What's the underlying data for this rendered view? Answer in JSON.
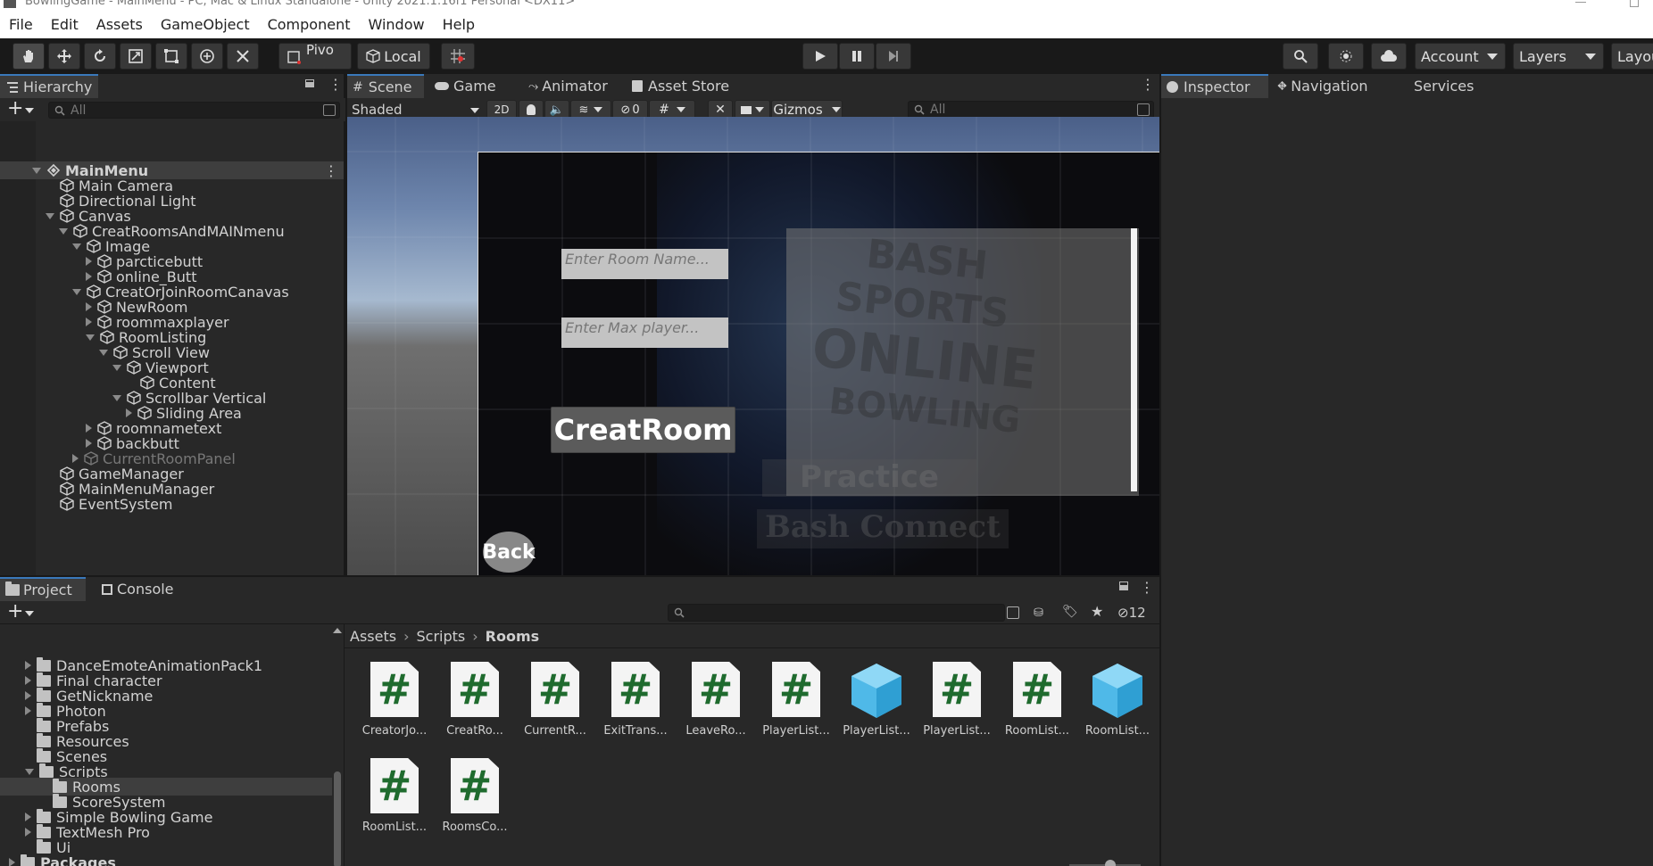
{
  "window": {
    "title": "BowlingGame - MainMenu - PC, Mac & Linux Standalone - Unity 2021.1.16f1 Personal <DX11>"
  },
  "menu": [
    "File",
    "Edit",
    "Assets",
    "GameObject",
    "Component",
    "Window",
    "Help"
  ],
  "toolbar": {
    "pivot": "Pivo",
    "local": "Local",
    "account": "Account",
    "layers": "Layers",
    "layout": "Layou"
  },
  "hierarchy": {
    "tab": "Hierarchy",
    "search_placeholder": "All",
    "items": [
      {
        "label": "MainMenu",
        "indent": 0,
        "expander": "down",
        "icon": "scene",
        "bold": true,
        "dim": false,
        "selected": true
      },
      {
        "label": "Main Camera",
        "indent": 1,
        "expander": "none",
        "icon": "cube",
        "bold": false,
        "dim": false
      },
      {
        "label": "Directional Light",
        "indent": 1,
        "expander": "none",
        "icon": "cube",
        "bold": false,
        "dim": false
      },
      {
        "label": "Canvas",
        "indent": 1,
        "expander": "down",
        "icon": "cube",
        "bold": false,
        "dim": false
      },
      {
        "label": "CreatRoomsAndMAINmenu",
        "indent": 2,
        "expander": "down",
        "icon": "cube",
        "bold": false,
        "dim": false
      },
      {
        "label": "Image",
        "indent": 3,
        "expander": "down",
        "icon": "cube",
        "bold": false,
        "dim": false
      },
      {
        "label": "parcticebutt",
        "indent": 4,
        "expander": "right",
        "icon": "cube",
        "bold": false,
        "dim": false
      },
      {
        "label": "online_Butt",
        "indent": 4,
        "expander": "right",
        "icon": "cube",
        "bold": false,
        "dim": false
      },
      {
        "label": "CreatOrJoinRoomCanavas",
        "indent": 3,
        "expander": "down",
        "icon": "cube",
        "bold": false,
        "dim": false
      },
      {
        "label": "NewRoom",
        "indent": 4,
        "expander": "right",
        "icon": "cube",
        "bold": false,
        "dim": false
      },
      {
        "label": "roommaxplayer",
        "indent": 4,
        "expander": "right",
        "icon": "cube",
        "bold": false,
        "dim": false
      },
      {
        "label": "RoomListing",
        "indent": 4,
        "expander": "down",
        "icon": "cube",
        "bold": false,
        "dim": false
      },
      {
        "label": "Scroll View",
        "indent": 5,
        "expander": "down",
        "icon": "cube",
        "bold": false,
        "dim": false
      },
      {
        "label": "Viewport",
        "indent": 6,
        "expander": "down",
        "icon": "cube",
        "bold": false,
        "dim": false
      },
      {
        "label": "Content",
        "indent": 7,
        "expander": "none",
        "icon": "cube",
        "bold": false,
        "dim": false
      },
      {
        "label": "Scrollbar Vertical",
        "indent": 6,
        "expander": "down",
        "icon": "cube",
        "bold": false,
        "dim": false
      },
      {
        "label": "Sliding Area",
        "indent": 7,
        "expander": "right",
        "icon": "cube",
        "bold": false,
        "dim": false
      },
      {
        "label": "roomnametext",
        "indent": 4,
        "expander": "right",
        "icon": "cube",
        "bold": false,
        "dim": false
      },
      {
        "label": "backbutt",
        "indent": 4,
        "expander": "right",
        "icon": "cube",
        "bold": false,
        "dim": false
      },
      {
        "label": "CurrentRoomPanel",
        "indent": 3,
        "expander": "right",
        "icon": "cube",
        "bold": false,
        "dim": true
      },
      {
        "label": "GameManager",
        "indent": 1,
        "expander": "none",
        "icon": "cube",
        "bold": false,
        "dim": false
      },
      {
        "label": "MainMenuManager",
        "indent": 1,
        "expander": "none",
        "icon": "cube",
        "bold": false,
        "dim": false
      },
      {
        "label": "EventSystem",
        "indent": 1,
        "expander": "none",
        "icon": "cube",
        "bold": false,
        "dim": false
      }
    ]
  },
  "scene": {
    "tabs": [
      "Scene",
      "Game",
      "Animator",
      "Asset Store"
    ],
    "shading": "Shaded",
    "mode_2d": "2D",
    "hidden_count": "0",
    "gizmos": "Gizmos",
    "search_placeholder": "All",
    "ui": {
      "room_name_placeholder": "Enter Room Name...",
      "max_player_placeholder": "Enter Max player...",
      "create_button": "CreatRoom",
      "back_button": "Back",
      "bg_line1": "BASH SPORTS",
      "bg_line2": "ONLINE",
      "bg_line3": "BOWLING",
      "bg_practice": "Practice",
      "bg_connect": "Bash Connect"
    }
  },
  "inspector": {
    "tabs": [
      "Inspector",
      "Navigation",
      "Services"
    ]
  },
  "project": {
    "tabs": [
      "Project",
      "Console"
    ],
    "hidden_count": "12",
    "breadcrumb": [
      "Assets",
      "Scripts",
      "Rooms"
    ],
    "folders": [
      {
        "label": "DanceEmoteAnimationPack1",
        "indent": 1,
        "expander": "right",
        "open": false
      },
      {
        "label": "Final character",
        "indent": 1,
        "expander": "right",
        "open": false
      },
      {
        "label": "GetNickname",
        "indent": 1,
        "expander": "right",
        "open": false
      },
      {
        "label": "Photon",
        "indent": 1,
        "expander": "right",
        "open": false
      },
      {
        "label": "Prefabs",
        "indent": 1,
        "expander": "none",
        "open": false
      },
      {
        "label": "Resources",
        "indent": 1,
        "expander": "none",
        "open": false
      },
      {
        "label": "Scenes",
        "indent": 1,
        "expander": "none",
        "open": false
      },
      {
        "label": "Scripts",
        "indent": 1,
        "expander": "down",
        "open": true
      },
      {
        "label": "Rooms",
        "indent": 2,
        "expander": "none",
        "open": false,
        "selected": true
      },
      {
        "label": "ScoreSystem",
        "indent": 2,
        "expander": "none",
        "open": false
      },
      {
        "label": "Simple Bowling Game",
        "indent": 1,
        "expander": "right",
        "open": false
      },
      {
        "label": "TextMesh Pro",
        "indent": 1,
        "expander": "right",
        "open": false
      },
      {
        "label": "Ui",
        "indent": 1,
        "expander": "none",
        "open": false
      },
      {
        "label": "Packages",
        "indent": 0,
        "expander": "right",
        "open": false,
        "bold": true
      }
    ],
    "assets": [
      {
        "label": "CreatorJo...",
        "type": "script"
      },
      {
        "label": "CreatRo...",
        "type": "script"
      },
      {
        "label": "CurrentR...",
        "type": "script"
      },
      {
        "label": "ExitTrans...",
        "type": "script"
      },
      {
        "label": "LeaveRo...",
        "type": "script"
      },
      {
        "label": "PlayerList...",
        "type": "script"
      },
      {
        "label": "PlayerList...",
        "type": "prefab"
      },
      {
        "label": "PlayerList...",
        "type": "script"
      },
      {
        "label": "RoomList...",
        "type": "script"
      },
      {
        "label": "RoomList...",
        "type": "prefab"
      },
      {
        "label": "RoomList...",
        "type": "script"
      },
      {
        "label": "RoomsCo...",
        "type": "script"
      }
    ]
  }
}
